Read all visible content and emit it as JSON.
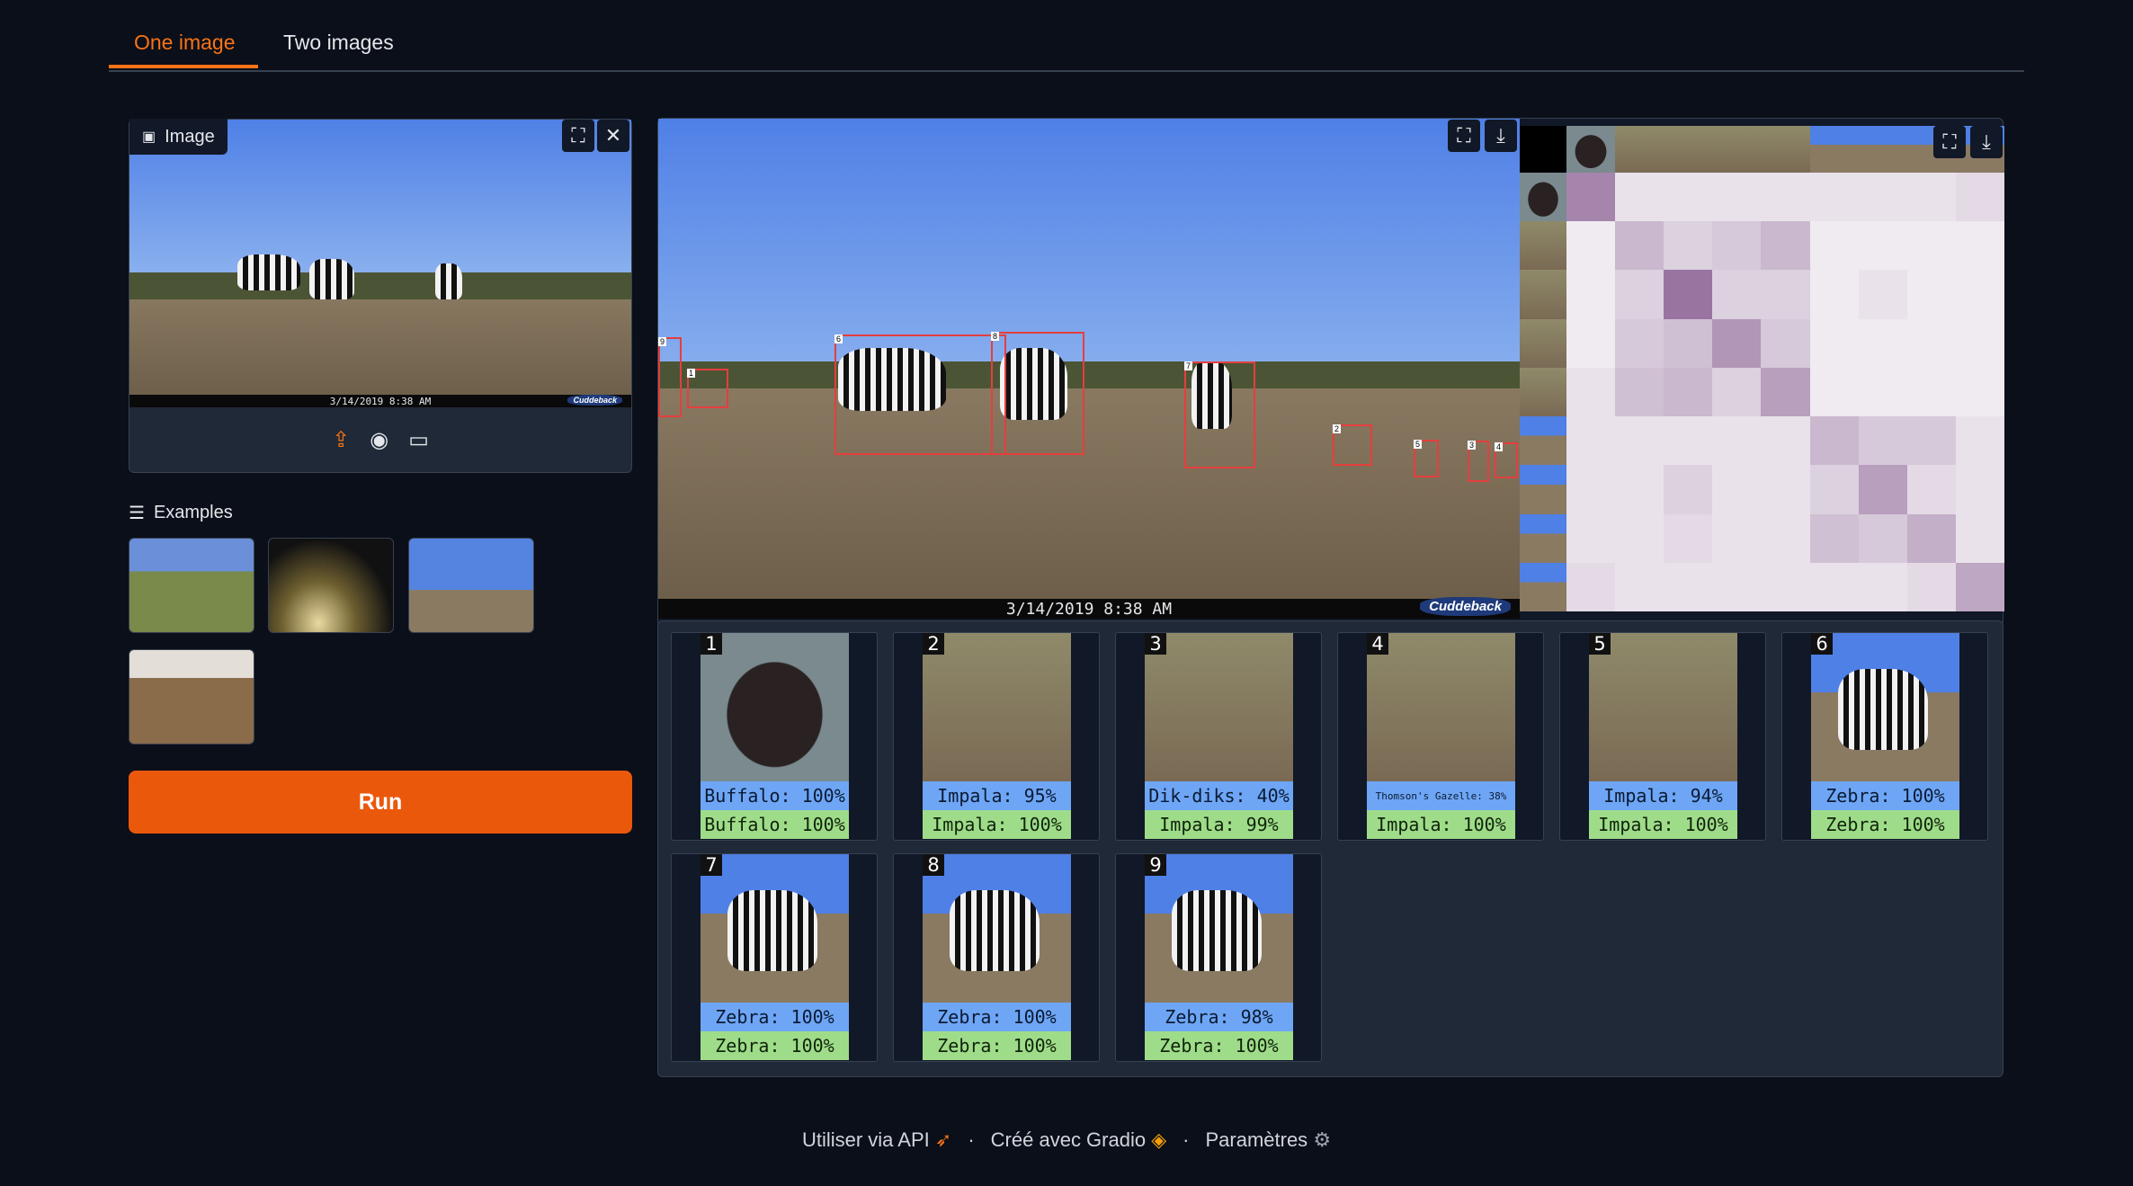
{
  "tabs": [
    {
      "label": "One image",
      "active": true
    },
    {
      "label": "Two images",
      "active": false
    }
  ],
  "input": {
    "label": "Image",
    "icons": [
      "image-icon",
      "fullscreen-icon",
      "close-icon",
      "upload-icon",
      "webcam-icon",
      "clipboard-icon"
    ],
    "timestamp": "3/14/2019   8:38 AM",
    "brand": "Cuddeback"
  },
  "examples": {
    "label": "Examples",
    "items": [
      "savanna-grassland",
      "night-scene",
      "zebras-savanna",
      "impala-grazing"
    ]
  },
  "run_label": "Run",
  "output": {
    "timestamp": "3/14/2019     8:38 AM",
    "brand": "Cuddeback",
    "detections": [
      "1",
      "2",
      "3",
      "4",
      "5",
      "6",
      "7",
      "8",
      "9"
    ]
  },
  "crops": [
    {
      "num": "1",
      "pred": "Buffalo: 100%",
      "truth": "Buffalo: 100%",
      "kind": "buffalo"
    },
    {
      "num": "2",
      "pred": "Impala: 95%",
      "truth": "Impala: 100%",
      "kind": "impala"
    },
    {
      "num": "3",
      "pred": "Dik-diks: 40%",
      "truth": "Impala: 99%",
      "kind": "impala"
    },
    {
      "num": "4",
      "pred": "Thomson's Gazelle: 38%",
      "truth": "Impala: 100%",
      "kind": "impala"
    },
    {
      "num": "5",
      "pred": "Impala: 94%",
      "truth": "Impala: 100%",
      "kind": "impala"
    },
    {
      "num": "6",
      "pred": "Zebra: 100%",
      "truth": "Zebra: 100%",
      "kind": "zebra"
    },
    {
      "num": "7",
      "pred": "Zebra: 100%",
      "truth": "Zebra: 100%",
      "kind": "zebra"
    },
    {
      "num": "8",
      "pred": "Zebra: 100%",
      "truth": "Zebra: 100%",
      "kind": "zebra"
    },
    {
      "num": "9",
      "pred": "Zebra: 98%",
      "truth": "Zebra: 100%",
      "kind": "zebra"
    }
  ],
  "heatmap": {
    "values": [
      [
        0.65,
        0.1,
        0.1,
        0.1,
        0.1,
        0.1,
        0.1,
        0.1,
        0.15
      ],
      [
        0.05,
        0.35,
        0.2,
        0.25,
        0.35,
        0.05,
        0.05,
        0.05,
        0.05
      ],
      [
        0.05,
        0.2,
        0.75,
        0.2,
        0.2,
        0.05,
        0.1,
        0.05,
        0.05
      ],
      [
        0.05,
        0.25,
        0.3,
        0.55,
        0.25,
        0.05,
        0.05,
        0.05,
        0.05
      ],
      [
        0.1,
        0.3,
        0.35,
        0.2,
        0.5,
        0.05,
        0.05,
        0.05,
        0.05
      ],
      [
        0.1,
        0.1,
        0.1,
        0.1,
        0.1,
        0.35,
        0.25,
        0.25,
        0.1
      ],
      [
        0.1,
        0.1,
        0.2,
        0.1,
        0.1,
        0.2,
        0.5,
        0.15,
        0.1
      ],
      [
        0.1,
        0.1,
        0.15,
        0.1,
        0.1,
        0.3,
        0.25,
        0.4,
        0.1
      ],
      [
        0.15,
        0.1,
        0.1,
        0.1,
        0.1,
        0.1,
        0.1,
        0.15,
        0.45
      ]
    ],
    "color_high": "#7a4a84",
    "color_low": "#f5f3f6"
  },
  "footer": {
    "api": "Utiliser via API",
    "built": "Créé avec Gradio",
    "settings": "Paramètres"
  },
  "colors": {
    "accent": "#f97316",
    "run": "#ea580c",
    "pred_bg": "#6ea6f5",
    "truth_bg": "#9fdc8a",
    "bbox": "#e53e3e"
  }
}
